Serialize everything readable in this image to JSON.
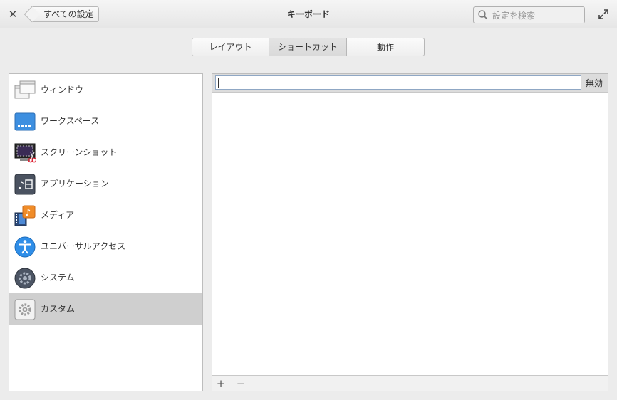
{
  "header": {
    "back_label": "すべての設定",
    "title": "キーボード",
    "search_placeholder": "設定を検索"
  },
  "tabs": [
    {
      "label": "レイアウト",
      "selected": false
    },
    {
      "label": "ショートカット",
      "selected": true
    },
    {
      "label": "動作",
      "selected": false
    }
  ],
  "categories": [
    {
      "label": "ウィンドウ",
      "icon": "window-icon"
    },
    {
      "label": "ワークスペース",
      "icon": "workspace-icon"
    },
    {
      "label": "スクリーンショット",
      "icon": "screenshot-icon"
    },
    {
      "label": "アプリケーション",
      "icon": "applications-icon"
    },
    {
      "label": "メディア",
      "icon": "media-icon"
    },
    {
      "label": "ユニバーサルアクセス",
      "icon": "accessibility-icon"
    },
    {
      "label": "システム",
      "icon": "system-icon"
    },
    {
      "label": "カスタム",
      "icon": "custom-gear-icon",
      "selected": true
    }
  ],
  "panel": {
    "command_value": "",
    "shortcut_label": "無効",
    "add_label": "+",
    "remove_label": "−"
  },
  "colors": {
    "selected_row": "#cfcfcf",
    "workspace_blue": "#3d8fe0",
    "media_orange": "#f08c28",
    "accessibility_blue": "#2f8ee8"
  }
}
